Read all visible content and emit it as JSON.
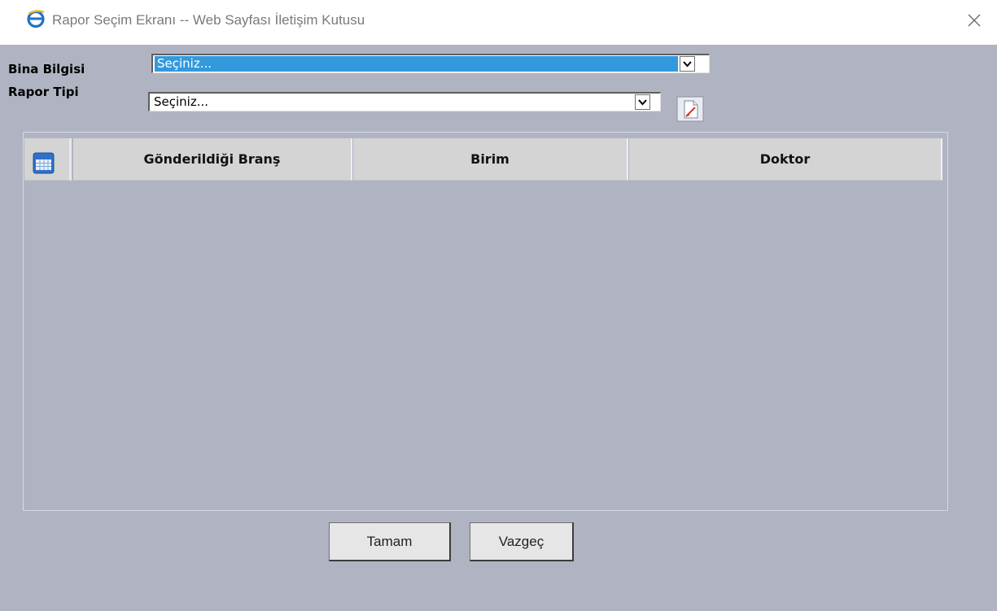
{
  "window": {
    "title": "Rapor Seçim Ekranı -- Web Sayfası İletişim Kutusu"
  },
  "form": {
    "building_label": "Bina Bilgisi",
    "building_value": "Seçiniz...",
    "report_type_label": "Rapor Tipi",
    "report_type_value": "Seçiniz..."
  },
  "grid": {
    "columns": [
      "Gönderildiği Branş",
      "Birim",
      "Doktor"
    ],
    "rows": []
  },
  "buttons": {
    "ok": "Tamam",
    "cancel": "Vazgeç"
  },
  "colors": {
    "dialog_background": "#b0b4c2",
    "selection_highlight": "#3399dd",
    "grid_header": "#d4d4d4"
  },
  "icons": {
    "title": "internet-explorer-icon",
    "close": "close-icon",
    "report": "report-document-icon",
    "grid_select": "grid-select-icon",
    "dropdown": "chevron-down-icon"
  }
}
